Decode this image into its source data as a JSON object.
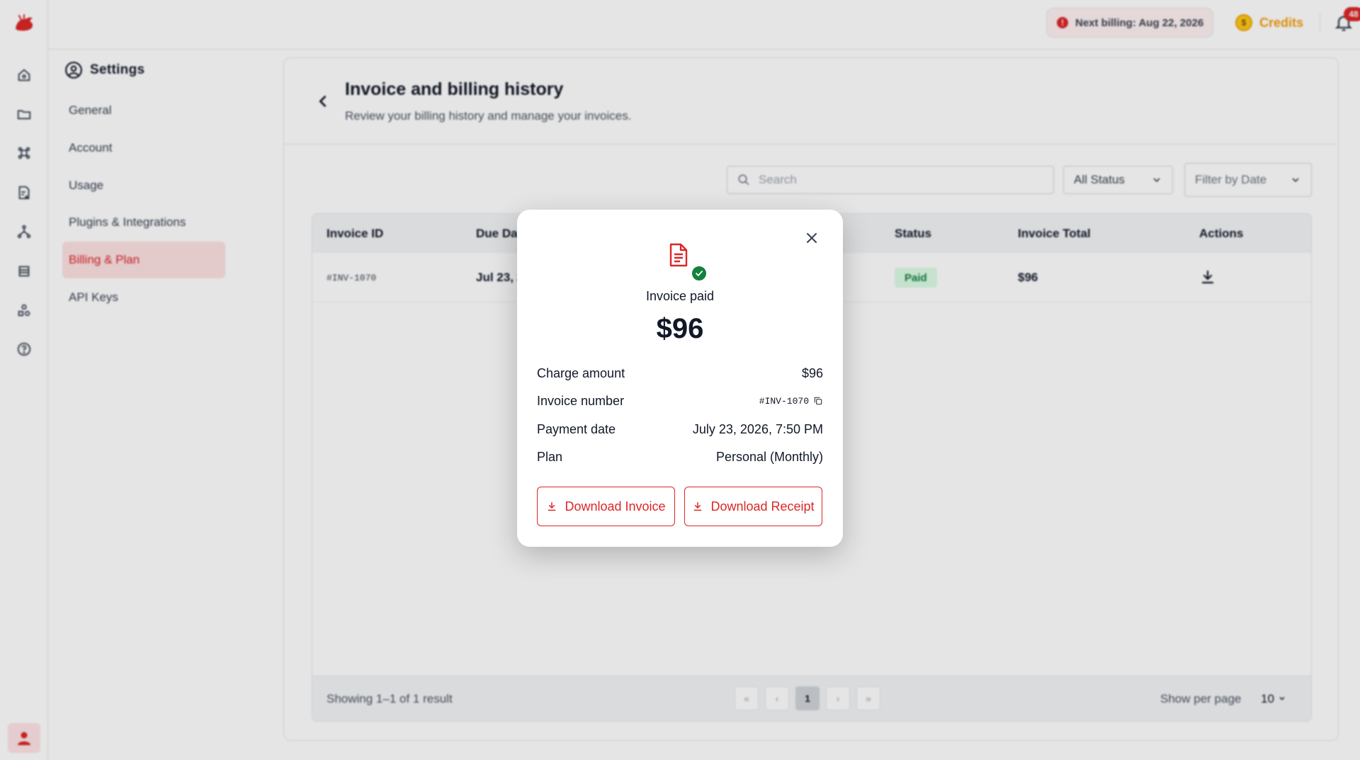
{
  "app": {
    "brand_color": "#dc2626"
  },
  "topbar": {
    "next_billing": "Next billing: Aug 22, 2026",
    "credits_label": "Credits",
    "notification_count": "48"
  },
  "settings": {
    "title": "Settings",
    "items": [
      {
        "label": "General"
      },
      {
        "label": "Account"
      },
      {
        "label": "Usage"
      },
      {
        "label": "Plugins & Integrations"
      },
      {
        "label": "Billing & Plan",
        "active": true
      },
      {
        "label": "API Keys"
      }
    ]
  },
  "page": {
    "title": "Invoice and billing history",
    "subtitle": "Review your billing history and manage your invoices."
  },
  "filters": {
    "search_placeholder": "Search",
    "status_value": "All Status",
    "date_value": "Filter by Date"
  },
  "table": {
    "columns": [
      "Invoice ID",
      "Due Da",
      "Status",
      "Invoice Total",
      "Actions"
    ],
    "rows": [
      {
        "invoice_id": "#INV-1070",
        "due_date": "Jul 23, 2",
        "status": "Paid",
        "total": "$96"
      }
    ],
    "footer": {
      "showing": "Showing 1–1 of 1 result",
      "pages": [
        "«",
        "‹",
        "1",
        "›",
        "»"
      ],
      "per_page_label": "Show per page",
      "per_page_value": "10"
    }
  },
  "modal": {
    "heading": "Invoice paid",
    "amount": "$96",
    "details": [
      {
        "label": "Charge amount",
        "value": "$96"
      },
      {
        "label": "Invoice number",
        "value": "#INV-1070"
      },
      {
        "label": "Payment date",
        "value": "July 23, 2026, 7:50 PM"
      },
      {
        "label": "Plan",
        "value": "Personal (Monthly)"
      }
    ],
    "download_invoice": "Download Invoice",
    "download_receipt": "Download Receipt"
  }
}
